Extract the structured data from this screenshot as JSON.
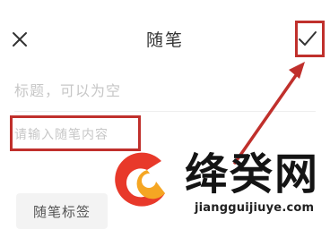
{
  "header": {
    "title": "随笔",
    "close_icon": "close-icon",
    "confirm_icon": "checkmark-icon"
  },
  "form": {
    "title_placeholder": "标题，可以为空",
    "content_placeholder": "请输入随笔内容",
    "tags_button_label": "随笔标签"
  },
  "annotations": {
    "highlight_color": "#c0302c"
  },
  "watermark": {
    "text": "绛癸网",
    "url": "jiangguijiuye.com"
  }
}
